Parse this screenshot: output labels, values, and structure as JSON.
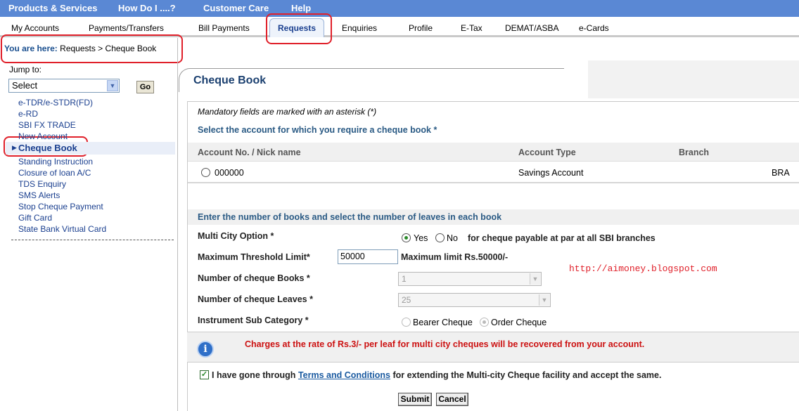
{
  "topnav": {
    "items": [
      "Products & Services",
      "How Do I ....?",
      "Customer Care",
      "Help"
    ]
  },
  "subnav": {
    "items": [
      "My Accounts",
      "Payments/Transfers",
      "Bill Payments",
      "Requests",
      "Enquiries",
      "Profile",
      "E-Tax",
      "DEMAT/ASBA",
      "e-Cards"
    ],
    "active": "Requests"
  },
  "breadcrumb": {
    "prefix": "You are here:",
    "path": "Requests > Cheque Book"
  },
  "sidebar": {
    "jump_label": "Jump to:",
    "select_value": "Select",
    "go_label": "Go",
    "links": [
      "e-TDR/e-STDR(FD)",
      "e-RD",
      "SBI FX TRADE",
      "New Account",
      "Cheque Book",
      "Standing Instruction",
      "Closure of loan A/C",
      "TDS Enquiry",
      "SMS Alerts",
      "Stop Cheque Payment",
      "Gift Card",
      "State Bank Virtual Card"
    ],
    "active": "Cheque Book"
  },
  "main": {
    "title": "Cheque Book",
    "mandatory_note": "Mandatory fields are marked with an asterisk (*)",
    "select_account_heading": "Select the account for which you require a cheque book *",
    "table": {
      "headers": [
        "Account No. / Nick name",
        "Account Type",
        "Branch"
      ],
      "rows": [
        {
          "account": "000000",
          "type": "Savings Account",
          "branch": "BRA"
        }
      ]
    },
    "books_heading": "Enter the number of books and select the number of leaves in each book",
    "multi_city": {
      "label": "Multi City Option *",
      "yes": "Yes",
      "no": "No",
      "selected": "Yes",
      "note": "for cheque payable at par at all SBI branches"
    },
    "threshold": {
      "label": "Maximum Threshold Limit*",
      "value": "50000",
      "note": "Maximum limit Rs.50000/-"
    },
    "books": {
      "label": "Number of cheque Books *",
      "value": "1"
    },
    "leaves": {
      "label": "Number of cheque Leaves *",
      "value": "25"
    },
    "instrument": {
      "label": "Instrument Sub Category *",
      "bearer": "Bearer Cheque",
      "order": "Order Cheque",
      "selected": "Order Cheque"
    },
    "blog_url": "http://aimoney.blogspot.com",
    "charges_note": "Charges at the rate of Rs.3/- per leaf for multi city cheques will be recovered from your account.",
    "terms": {
      "prefix": "I have gone through",
      "link": "Terms and Conditions",
      "suffix": "for extending the Multi-city Cheque facility and accept the same.",
      "checked": true
    },
    "submit_label": "Submit",
    "cancel_label": "Cancel"
  },
  "colors": {
    "topnav_bg": "#5a88d4",
    "highlight_red": "#e0202a",
    "heading_blue": "#2a5a84"
  }
}
